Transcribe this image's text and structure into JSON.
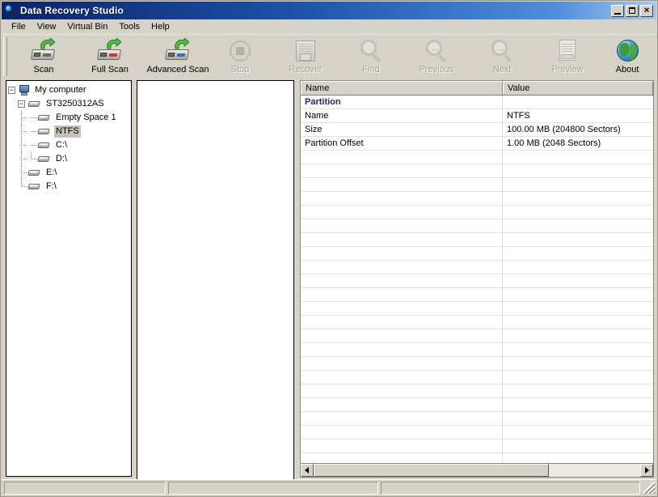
{
  "window": {
    "title": "Data Recovery Studio",
    "icon": "magnifier-icon",
    "controls": {
      "minimize_label": "_",
      "maximize_label": "□",
      "close_label": "×"
    }
  },
  "menu": {
    "items": [
      {
        "label": "File"
      },
      {
        "label": "View"
      },
      {
        "label": "Virtual Bin"
      },
      {
        "label": "Tools"
      },
      {
        "label": "Help"
      }
    ]
  },
  "toolbar": {
    "buttons": [
      {
        "label": "Scan",
        "icon": "hard-drive-scan-icon",
        "enabled": true,
        "accent": "#3a9b35"
      },
      {
        "label": "Full Scan",
        "icon": "hard-drive-full-scan-icon",
        "enabled": true,
        "accent": "#c0392b"
      },
      {
        "label": "Advanced Scan",
        "icon": "hard-drive-advanced-scan-icon",
        "enabled": true,
        "accent": "#2b6fc0"
      },
      {
        "label": "Stop",
        "icon": "stop-icon",
        "enabled": false,
        "accent": "#b3b0a8"
      },
      {
        "label": "Recover",
        "icon": "recover-disk-icon",
        "enabled": false,
        "accent": "#b3b0a8"
      },
      {
        "label": "Find",
        "icon": "search-icon",
        "enabled": false,
        "accent": "#b3b0a8"
      },
      {
        "label": "Previous",
        "icon": "search-previous-icon",
        "enabled": false,
        "accent": "#b3b0a8"
      },
      {
        "label": "Next",
        "icon": "search-next-icon",
        "enabled": false,
        "accent": "#b3b0a8"
      },
      {
        "label": "Preview",
        "icon": "preview-document-icon",
        "enabled": false,
        "accent": "#b3b0a8"
      },
      {
        "label": "About",
        "icon": "globe-icon",
        "enabled": true,
        "accent": "#3f9a3a"
      }
    ]
  },
  "tree": {
    "nodes": [
      {
        "label": "My computer",
        "icon": "computer-icon",
        "level": 0,
        "expander": "minus",
        "selected": false
      },
      {
        "label": "ST3250312AS",
        "icon": "disk-icon",
        "level": 1,
        "expander": "minus",
        "selected": false
      },
      {
        "label": "Empty Space 1",
        "icon": "disk-icon",
        "level": 2,
        "expander": "none",
        "selected": false
      },
      {
        "label": "NTFS",
        "icon": "disk-icon",
        "level": 2,
        "expander": "none",
        "selected": true
      },
      {
        "label": "C:\\",
        "icon": "disk-icon",
        "level": 2,
        "expander": "none",
        "selected": false
      },
      {
        "label": "D:\\",
        "icon": "disk-icon",
        "level": 2,
        "expander": "none",
        "selected": false
      },
      {
        "label": "E:\\",
        "icon": "disk-icon",
        "level": 1,
        "expander": "none",
        "selected": false
      },
      {
        "label": "F:\\",
        "icon": "disk-icon",
        "level": 1,
        "expander": "none",
        "selected": false
      }
    ]
  },
  "file_list": {
    "items": []
  },
  "details": {
    "columns": [
      {
        "label": "Name"
      },
      {
        "label": "Value"
      }
    ],
    "rows": [
      {
        "name": "Partition",
        "value": "",
        "group": true
      },
      {
        "name": "Name",
        "value": "NTFS",
        "group": false
      },
      {
        "name": "Size",
        "value": "100.00 MB (204800 Sectors)",
        "group": false
      },
      {
        "name": "Partition Offset",
        "value": "1.00 MB (2048 Sectors)",
        "group": false
      }
    ],
    "empty_row_count": 24
  },
  "scrollbar": {
    "left_arrow": "◄",
    "right_arrow": "►",
    "thumb_percent": 72
  },
  "statusbar": {
    "panes": [
      "",
      "",
      ""
    ]
  },
  "colors": {
    "title_start": "#0a246a",
    "title_end": "#a8c8ee",
    "face": "#d6d2c8",
    "group_text": "#1d2a66",
    "selection": "#c5c2ba"
  }
}
